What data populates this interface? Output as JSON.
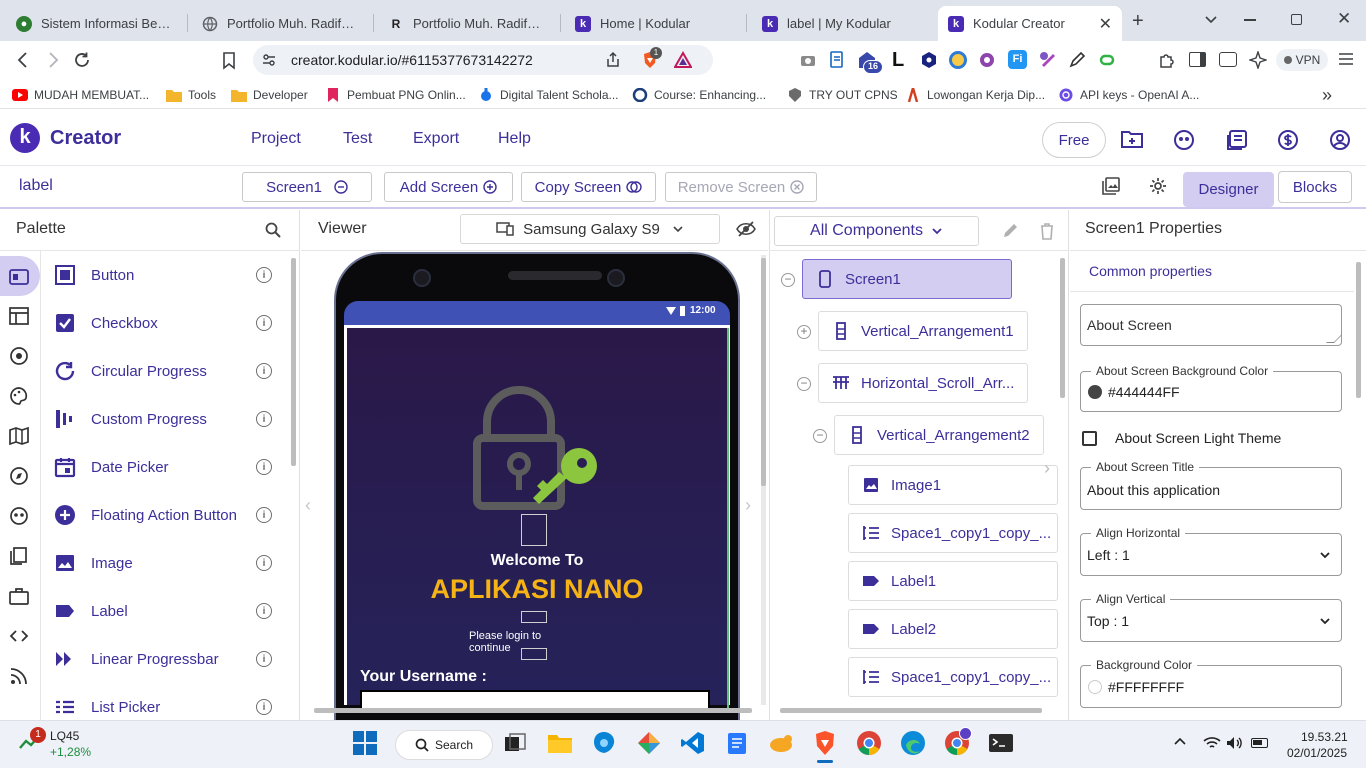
{
  "browser": {
    "tabs": [
      {
        "title": "Sistem Informasi Berbasis",
        "icon": "university-logo-icon",
        "color": "#2e7d32"
      },
      {
        "title": "Portfolio Muh. Radifansya",
        "icon": "globe-icon",
        "color": "#5f6368"
      },
      {
        "title": "Portfolio Muh. Radifansya",
        "icon": "rs-logo-icon",
        "color": "#222222"
      },
      {
        "title": "Home | Kodular",
        "icon": "kodular-logo-icon",
        "color": "#4a2bb3"
      },
      {
        "title": "label | My Kodular",
        "icon": "kodular-logo-icon",
        "color": "#4a2bb3"
      },
      {
        "title": "Kodular Creator",
        "icon": "kodular-logo-icon",
        "color": "#4a2bb3",
        "active": true
      }
    ],
    "url": "creator.kodular.io/#6115377673142272",
    "brave_badge": "1",
    "extensions_badge": "16",
    "vpn_label": "VPN",
    "bookmarks": [
      {
        "label": "MUDAH MEMBUAT...",
        "icon": "youtube-icon",
        "color": "#ff0000"
      },
      {
        "label": "Tools",
        "icon": "folder-icon",
        "color": "#f2b52c"
      },
      {
        "label": "Developer",
        "icon": "folder-icon",
        "color": "#f2b52c"
      },
      {
        "label": "Pembuat PNG Onlin...",
        "icon": "bookmark-icon",
        "color": "#e0245e"
      },
      {
        "label": "Digital Talent Schola...",
        "icon": "dts-icon",
        "color": "#1a73e8"
      },
      {
        "label": "Course: Enhancing...",
        "icon": "course-icon",
        "color": "#1c3f7a"
      },
      {
        "label": "TRY OUT CPNS",
        "icon": "badge-icon",
        "color": "#6b6b6b"
      },
      {
        "label": "Lowongan Kerja Dip...",
        "icon": "job-icon",
        "color": "#d04020"
      },
      {
        "label": "API keys - OpenAI A...",
        "icon": "openai-icon",
        "color": "#6b4de6"
      }
    ]
  },
  "app": {
    "brand": "Creator",
    "menu": [
      "Project",
      "Test",
      "Export",
      "Help"
    ],
    "plan_label": "Free",
    "project_name": "label",
    "screen_select": "Screen1",
    "add_screen": "Add Screen",
    "copy_screen": "Copy Screen",
    "remove_screen": "Remove Screen",
    "designer_tab": "Designer",
    "blocks_tab": "Blocks"
  },
  "palette": {
    "title": "Palette",
    "items": [
      {
        "label": "Button",
        "icon": "button-icon"
      },
      {
        "label": "Checkbox",
        "icon": "checkbox-icon"
      },
      {
        "label": "Circular Progress",
        "icon": "circular-progress-icon"
      },
      {
        "label": "Custom Progress",
        "icon": "custom-progress-icon"
      },
      {
        "label": "Date Picker",
        "icon": "date-picker-icon"
      },
      {
        "label": "Floating Action Button",
        "icon": "fab-icon"
      },
      {
        "label": "Image",
        "icon": "image-icon"
      },
      {
        "label": "Label",
        "icon": "label-icon"
      },
      {
        "label": "Linear Progressbar",
        "icon": "linear-progressbar-icon"
      },
      {
        "label": "List Picker",
        "icon": "list-picker-icon"
      }
    ]
  },
  "viewer": {
    "title": "Viewer",
    "device": "Samsung Galaxy S9",
    "status_time": "12:00",
    "welcome": "Welcome To",
    "app_title": "APLIKASI NANO",
    "login_text": "Please login to continue",
    "username_label": "Your Username :",
    "bg_color": "#2a1d55",
    "title_color": "#f5b316",
    "key_color": "#8cc63f"
  },
  "components": {
    "dropdown": "All Components",
    "tree": [
      {
        "label": "Screen1",
        "icon": "phone-icon",
        "selected": true
      },
      {
        "label": "Vertical_Arrangement1",
        "icon": "vertical-arrangement-icon"
      },
      {
        "label": "Horizontal_Scroll_Arr...",
        "icon": "horizontal-scroll-icon"
      },
      {
        "label": "Vertical_Arrangement2",
        "icon": "vertical-arrangement-icon"
      },
      {
        "label": "Image1",
        "icon": "image-icon"
      },
      {
        "label": "Space1_copy1_copy_...",
        "icon": "space-icon"
      },
      {
        "label": "Label1",
        "icon": "label-icon"
      },
      {
        "label": "Label2",
        "icon": "label-icon"
      },
      {
        "label": "Space1_copy1_copy_...",
        "icon": "space-icon"
      }
    ]
  },
  "properties": {
    "title": "Screen1 Properties",
    "section": "Common properties",
    "about_screen_placeholder": "About Screen",
    "bg_color_label": "About Screen Background Color",
    "bg_color_value": "#444444FF",
    "light_theme_label": "About Screen Light Theme",
    "title_label": "About Screen Title",
    "title_value": "About this application",
    "align_h_label": "Align Horizontal",
    "align_h_value": "Left : 1",
    "align_v_label": "Align Vertical",
    "align_v_value": "Top : 1",
    "background_label": "Background Color",
    "background_value": "#FFFFFFFF"
  },
  "taskbar": {
    "stock_name": "LQ45",
    "stock_change": "+1,28%",
    "notification_badge": "1",
    "search_label": "Search",
    "time": "19.53.21",
    "date": "02/01/2025"
  }
}
